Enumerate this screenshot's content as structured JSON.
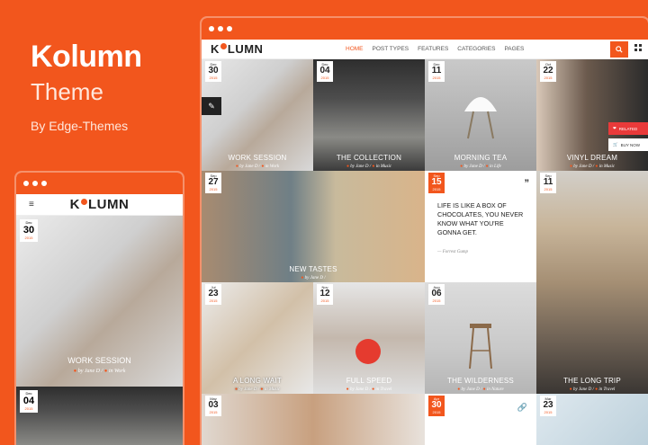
{
  "brand": {
    "title": "Kolumn",
    "subtitle": "Theme",
    "byline": "By Edge-Themes"
  },
  "site": {
    "logo_pre": "K",
    "logo_post": "LUMN",
    "nav": [
      "HOME",
      "POST TYPES",
      "FEATURES",
      "CATEGORIES",
      "PAGES"
    ],
    "search_icon": "search-icon",
    "menu_icon": "menu-icon"
  },
  "tiles": [
    {
      "month": "Dec",
      "day": "30",
      "year": "2015",
      "title": "WORK SESSION",
      "author": "by Jane D /",
      "cat": "in Work"
    },
    {
      "month": "Dec",
      "day": "04",
      "year": "2015",
      "title": "THE COLLECTION",
      "author": "by Jane D /",
      "cat": "in Music"
    },
    {
      "month": "Dec",
      "day": "11",
      "year": "2015",
      "title": "MORNING TEA",
      "author": "by Jane D /",
      "cat": "in Life"
    },
    {
      "month": "Oct",
      "day": "22",
      "year": "2015",
      "title": "VINYL DREAM",
      "author": "by Jane D /",
      "cat": "in Music"
    },
    {
      "month": "Sep",
      "day": "27",
      "year": "2015",
      "title": "NEW TASTES",
      "author": "by Jane D /",
      "cat": ""
    },
    {
      "month": "Sep",
      "day": "15",
      "year": "2015",
      "title": "",
      "author": "",
      "cat": ""
    },
    {
      "month": "Sep",
      "day": "11",
      "year": "2015",
      "title": "",
      "author": "",
      "cat": ""
    },
    {
      "month": "Jul",
      "day": "23",
      "year": "2015",
      "title": "A LONG WAIT",
      "author": "by Jane D /",
      "cat": "in Music"
    },
    {
      "month": "Nov",
      "day": "12",
      "year": "2015",
      "title": "FULL SPEED",
      "author": "by Jane D /",
      "cat": "in Travel"
    },
    {
      "month": "Aug",
      "day": "06",
      "year": "2015",
      "title": "THE WILDERNESS",
      "author": "by Jane D /",
      "cat": "in Nature"
    },
    {
      "month": "",
      "day": "",
      "year": "",
      "title": "THE LONG TRIP",
      "author": "by Jane D /",
      "cat": "in Travel"
    },
    {
      "month": "May",
      "day": "03",
      "year": "2015",
      "title": "",
      "author": "",
      "cat": ""
    },
    {
      "month": "Apr",
      "day": "30",
      "year": "2015",
      "title": "",
      "author": "",
      "cat": ""
    },
    {
      "month": "Mar",
      "day": "23",
      "year": "2015",
      "title": "",
      "author": "",
      "cat": ""
    }
  ],
  "quote": {
    "text": "LIFE IS LIKE A BOX OF CHOCOLATES, YOU NEVER KNOW WHAT YOU'RE GONNA GET.",
    "author": "— Forrest Gump"
  },
  "side_tags": {
    "related": "RELATED",
    "buy": "BUY NOW"
  },
  "mobile": {
    "logo_pre": "K",
    "logo_post": "LUMN",
    "tiles": [
      {
        "month": "Dec",
        "day": "30",
        "year": "2015",
        "title": "WORK SESSION",
        "author": "by Jane D /",
        "cat": "in Work"
      },
      {
        "month": "Dec",
        "day": "04",
        "year": "2015"
      }
    ]
  },
  "colors": {
    "accent": "#f2561d",
    "red_tag": "#e93a3a"
  }
}
